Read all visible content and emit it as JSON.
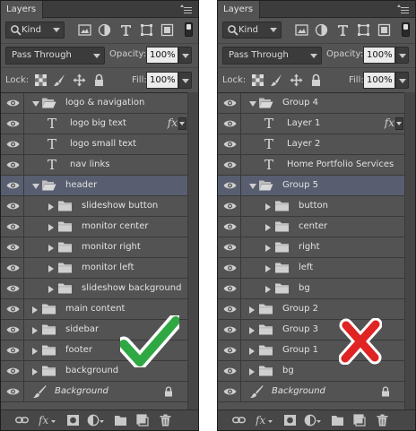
{
  "panels": [
    {
      "id": "left",
      "tab_title": "Layers",
      "filter_kind": "Kind",
      "blend_mode": "Pass Through",
      "opacity_label": "Opacity:",
      "opacity_value": "100%",
      "lock_label": "Lock:",
      "fill_label": "Fill:",
      "fill_value": "100%",
      "verdict_icon": "green-checkmark-icon",
      "verdict_color": "#2fa843",
      "layers": [
        {
          "name": "logo & navigation",
          "type": "group",
          "depth": 0,
          "expanded": true
        },
        {
          "name": "logo big text",
          "type": "text",
          "depth": 1,
          "fx": "fx"
        },
        {
          "name": "logo small text",
          "type": "text",
          "depth": 1
        },
        {
          "name": "nav links",
          "type": "text",
          "depth": 1
        },
        {
          "name": "header",
          "type": "group",
          "depth": 0,
          "expanded": true,
          "selected": true
        },
        {
          "name": "slideshow button",
          "type": "group",
          "depth": 1
        },
        {
          "name": "monitor center",
          "type": "group",
          "depth": 1
        },
        {
          "name": "monitor right",
          "type": "group",
          "depth": 1
        },
        {
          "name": "monitor left",
          "type": "group",
          "depth": 1
        },
        {
          "name": "slideshow background",
          "type": "group",
          "depth": 1
        },
        {
          "name": "main content",
          "type": "group",
          "depth": 0
        },
        {
          "name": "sidebar",
          "type": "group",
          "depth": 0
        },
        {
          "name": "footer",
          "type": "group",
          "depth": 0
        },
        {
          "name": "background",
          "type": "group",
          "depth": 0
        },
        {
          "name": "Background",
          "type": "background",
          "depth": 0,
          "locked": true
        }
      ]
    },
    {
      "id": "right",
      "tab_title": "Layers",
      "filter_kind": "Kind",
      "blend_mode": "Pass Through",
      "opacity_label": "Opacity:",
      "opacity_value": "100%",
      "lock_label": "Lock:",
      "fill_label": "Fill:",
      "fill_value": "100%",
      "verdict_icon": "red-cross-icon",
      "verdict_color": "#e02323",
      "layers": [
        {
          "name": "Group 4",
          "type": "group",
          "depth": 0,
          "expanded": true
        },
        {
          "name": "Layer 1",
          "type": "text",
          "depth": 1,
          "fx": "fx"
        },
        {
          "name": "Layer 2",
          "type": "text",
          "depth": 1
        },
        {
          "name": "Home Portfolio Services",
          "type": "text",
          "depth": 1
        },
        {
          "name": "Group 5",
          "type": "group",
          "depth": 0,
          "expanded": true,
          "selected": true
        },
        {
          "name": "button",
          "type": "group",
          "depth": 1
        },
        {
          "name": "center",
          "type": "group",
          "depth": 1
        },
        {
          "name": "right",
          "type": "group",
          "depth": 1
        },
        {
          "name": "left",
          "type": "group",
          "depth": 1
        },
        {
          "name": "bg",
          "type": "group",
          "depth": 1
        },
        {
          "name": "Group 2",
          "type": "group",
          "depth": 0
        },
        {
          "name": "Group 3",
          "type": "group",
          "depth": 0
        },
        {
          "name": "Group 1",
          "type": "group",
          "depth": 0
        },
        {
          "name": "bg",
          "type": "group",
          "depth": 0
        },
        {
          "name": "Background",
          "type": "background",
          "depth": 0,
          "locked": true
        }
      ]
    }
  ]
}
